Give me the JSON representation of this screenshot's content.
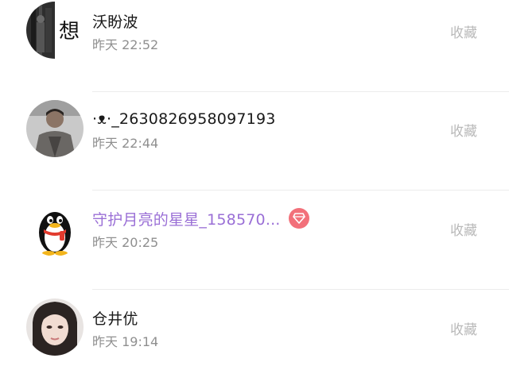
{
  "items": [
    {
      "name": "沃盼波",
      "time": "昨天 22:52",
      "action": "收藏",
      "avatar_text": "想",
      "avatar": "dark-street-photo-with-xiang-glyph"
    },
    {
      "name": "·ᴥ·_2630826958097193",
      "time": "昨天 22:44",
      "action": "收藏",
      "avatar": "man-in-grey-coat-photo"
    },
    {
      "name": "守护月亮的星星_158570...",
      "time": "昨天 20:25",
      "action": "收藏",
      "vip": true,
      "name_color": "#9a6fd6",
      "badge_color": "#f2707a",
      "avatar": "qq-penguin-icon"
    },
    {
      "name": "仓井优",
      "time": "昨天 19:14",
      "action": "收藏",
      "avatar": "woman-portrait-photo"
    }
  ]
}
